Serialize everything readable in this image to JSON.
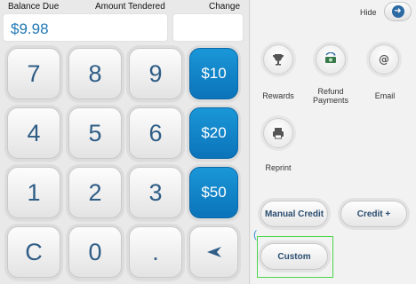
{
  "header": {
    "balance_due_label": "Balance Due",
    "amount_tendered_label": "Amount Tendered",
    "change_label": "Change"
  },
  "fields": {
    "balance_due_value": "$9.98",
    "change_value": ""
  },
  "keypad": {
    "k7": "7",
    "k8": "8",
    "k9": "9",
    "q10": "$10",
    "k4": "4",
    "k5": "5",
    "k6": "6",
    "q20": "$20",
    "k1": "1",
    "k2": "2",
    "k3": "3",
    "q50": "$50",
    "clear": "C",
    "k0": "0",
    "dot": "."
  },
  "right_panel": {
    "hide_label": "Hide",
    "actions": {
      "rewards": "Rewards",
      "refund_line1": "Refund",
      "refund_line2": "Payments",
      "email": "Email",
      "reprint": "Reprint"
    },
    "buttons": {
      "manual_credit": "Manual Credit",
      "credit_plus": "Credit +",
      "custom": "Custom"
    }
  },
  "colors": {
    "accent_blue": "#0b73b9",
    "digit_text": "#2f5d86",
    "balance_text": "#1f78b4",
    "highlight": "#4cd64c"
  },
  "icons": {
    "rewards": "trophy-icon",
    "refund": "refund-icon",
    "email": "at-icon",
    "reprint": "printer-icon",
    "hide": "arrow-right-icon",
    "enter": "enter-arrow-icon"
  }
}
